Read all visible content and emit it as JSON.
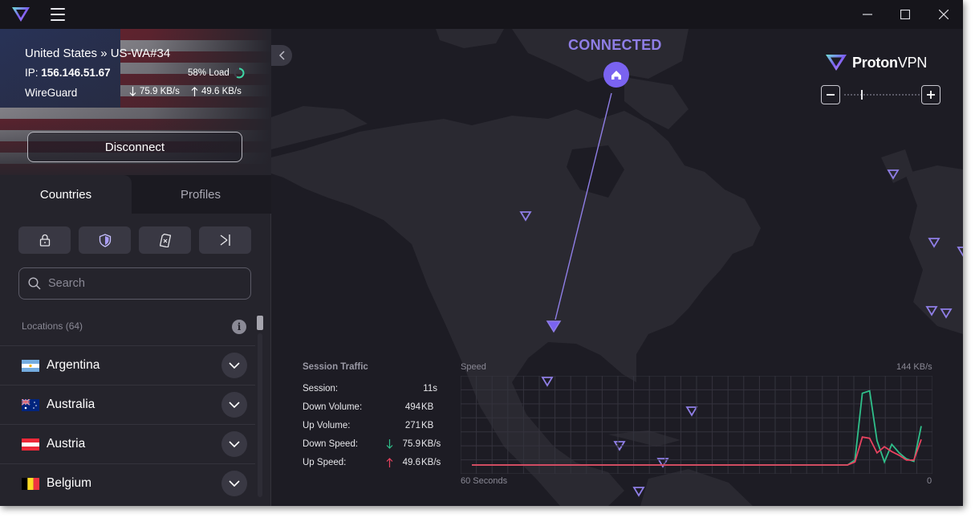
{
  "window": {
    "controls": [
      "minimize",
      "maximize",
      "close"
    ]
  },
  "header": {
    "server": "United States » US-WA#34",
    "ip_label": "IP:",
    "ip": "156.146.51.67",
    "load": "58% Load",
    "load_fraction": 0.58,
    "protocol": "WireGuard",
    "down_speed": "75.9 KB/s",
    "up_speed": "49.6 KB/s",
    "disconnect_label": "Disconnect"
  },
  "tabs": [
    {
      "label": "Countries",
      "active": true
    },
    {
      "label": "Profiles",
      "active": false
    }
  ],
  "filters": [
    {
      "name": "secure-core-filter",
      "icon": "lock-icon"
    },
    {
      "name": "netshield-filter",
      "icon": "shield-icon"
    },
    {
      "name": "p2p-filter",
      "icon": "sim-card-icon"
    },
    {
      "name": "tor-filter",
      "icon": "split-arrow-icon"
    }
  ],
  "search": {
    "placeholder": "Search",
    "value": ""
  },
  "locations_label": "Locations (64)",
  "countries": [
    {
      "name": "Argentina",
      "flag": "argentina-flag-icon"
    },
    {
      "name": "Australia",
      "flag": "australia-flag-icon"
    },
    {
      "name": "Austria",
      "flag": "austria-flag-icon"
    },
    {
      "name": "Belgium",
      "flag": "belgium-flag-icon"
    }
  ],
  "map": {
    "status": "CONNECTED",
    "brand_bold": "Proton",
    "brand_light": "VPN",
    "accent": "#8f7ee6"
  },
  "session": {
    "title": "Session Traffic",
    "rows": [
      {
        "label": "Session:",
        "value": "11s",
        "unit": ""
      },
      {
        "label": "Down Volume:",
        "value": "494",
        "unit": "KB"
      },
      {
        "label": "Up Volume:",
        "value": "271",
        "unit": "KB"
      },
      {
        "label": "Down Speed:",
        "value": "75.9",
        "unit": "KB/s"
      },
      {
        "label": "Up Speed:",
        "value": "49.6",
        "unit": "KB/s"
      }
    ]
  },
  "chart_data": {
    "type": "line",
    "title": "Speed",
    "ymax_label": "144  KB/s",
    "xlabel_left": "60 Seconds",
    "xlabel_right": "0",
    "ylim": [
      0,
      144
    ],
    "series": [
      {
        "color": "#2fbf8a",
        "values": [
          0,
          0,
          0,
          0,
          0,
          0,
          0,
          0,
          0,
          0,
          0,
          0,
          0,
          0,
          0,
          0,
          0,
          0,
          0,
          0,
          0,
          0,
          0,
          0,
          0,
          0,
          0,
          0,
          0,
          0,
          0,
          0,
          0,
          0,
          0,
          0,
          0,
          0,
          0,
          0,
          0,
          0,
          0,
          0,
          0,
          0,
          0,
          0,
          0,
          0,
          0,
          0,
          8,
          118,
          122,
          40,
          5,
          34,
          20,
          10,
          6,
          64
        ]
      },
      {
        "color": "#e8425f",
        "values": [
          0,
          0,
          0,
          0,
          0,
          0,
          0,
          0,
          0,
          0,
          0,
          0,
          0,
          0,
          0,
          0,
          0,
          0,
          0,
          0,
          0,
          0,
          0,
          0,
          0,
          0,
          0,
          0,
          0,
          0,
          0,
          0,
          0,
          0,
          0,
          0,
          0,
          0,
          0,
          0,
          0,
          0,
          0,
          0,
          0,
          0,
          0,
          0,
          0,
          0,
          0,
          0,
          5,
          46,
          44,
          20,
          30,
          22,
          16,
          8,
          8,
          42
        ]
      }
    ]
  }
}
